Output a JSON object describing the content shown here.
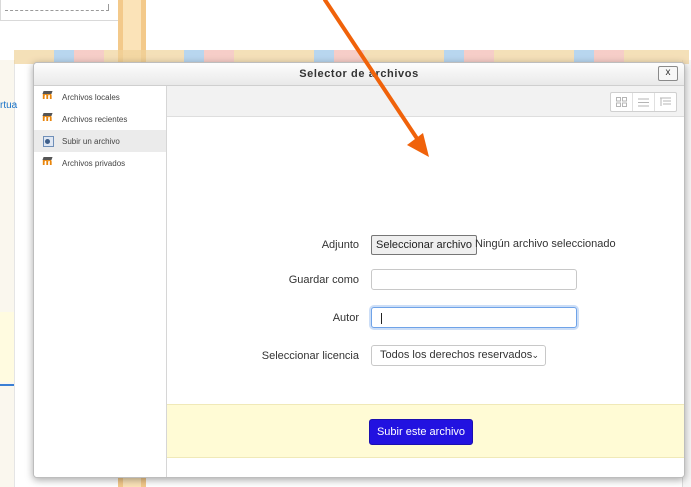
{
  "background": {
    "left_fragment": "rtua"
  },
  "dialog": {
    "title": "Selector de archivos",
    "close_glyph": "x"
  },
  "sidebar": {
    "items": [
      {
        "label": "Archivos locales",
        "icon": "moodle-icon"
      },
      {
        "label": "Archivos recientes",
        "icon": "moodle-icon"
      },
      {
        "label": "Subir un archivo",
        "icon": "upload-icon",
        "active": true
      },
      {
        "label": "Archivos privados",
        "icon": "moodle-icon"
      }
    ]
  },
  "toolbar": {
    "views": [
      "icons-view-icon",
      "list-view-icon",
      "tree-view-icon"
    ]
  },
  "form": {
    "attachment": {
      "label": "Adjunto",
      "button_label": "Seleccionar archivo",
      "status": "Ningún archivo seleccionado"
    },
    "save_as": {
      "label": "Guardar como",
      "value": ""
    },
    "author": {
      "label": "Autor",
      "value": ""
    },
    "license": {
      "label": "Seleccionar licencia",
      "selected": "Todos los derechos reservados"
    },
    "submit_label": "Subir este archivo"
  },
  "colors": {
    "submit_button": "#2212e0",
    "submit_band": "#fffbd5",
    "annotation_arrow": "#f0620a",
    "moodle_orange": "#e8850b"
  }
}
